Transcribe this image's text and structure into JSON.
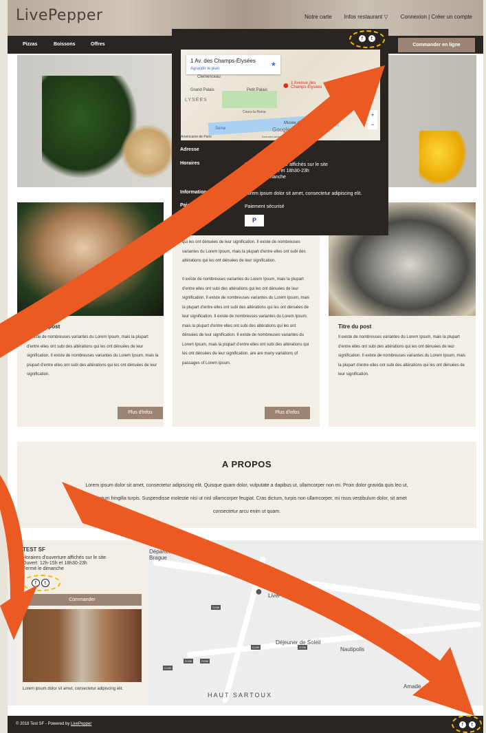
{
  "brand": {
    "logo": "LivePepper"
  },
  "topnav": {
    "items": [
      "Notre carte",
      "Infos restaurant ▽",
      "Connexion | Créer un compte"
    ]
  },
  "navbar": {
    "items": [
      "Pizzas",
      "Boissons",
      "Offres"
    ],
    "order_label": "Commander en ligne"
  },
  "dropdown": {
    "map_address": "1 Av. des Champs-Élysées",
    "map_enlarge": "Agrandir le plan",
    "map_pin_label": "1 Avenue des Champs-Élysées",
    "map_places": [
      "Clemenceau",
      "Grand Palais",
      "Petit Palais",
      "LYSÉES",
      "Cours-la-Reine",
      "Seine",
      "Musée de l'Orangerie",
      "Seine",
      "Américaine de Paris"
    ],
    "map_footer": "Données cartographiques  Conditions d'utilisation",
    "google": "Google",
    "rows": [
      {
        "label": "Adresse",
        "value": ""
      },
      {
        "label": "Horaires",
        "value": "Horaires d'ouverture affichés sur le site\nOuvert: 12h-15h et 18h30-23h\nFermé le dimanche"
      },
      {
        "label": "Information",
        "value": "Lorem ipsum dolor sit amet, consectetur adipiscing elit."
      },
      {
        "label": "Paiement",
        "value": "Paiement sécurisé"
      }
    ],
    "pay_icon": "P"
  },
  "cards": [
    {
      "title": "Titre du post",
      "text": "Il existe de nombreuses variantes du Lorem Ipsum, mais la plupart d'entre elles ont subi des altérations qui les ont dénuées de leur signification. Il existe de nombreuses variantes du Lorem Ipsum, mais la plupart d'entre elles ont subi des altérations qui les ont dénuées de leur signification.",
      "button": "Plus d'infos"
    },
    {
      "title": "",
      "text": "qui les ont dénuées de leur signification. Il existe de nombreuses variantes du Lorem Ipsum, mais la plupart d'entre elles ont subi des altérations qui les ont dénuées de leur signification.\n\nIl existe de nombreuses variantes du Lorem Ipsum, mais la plupart d'entre elles ont subi des altérations qui les ont dénuées de leur signification. Il existe de nombreuses variantes du Lorem Ipsum, mais la plupart d'entre elles ont subi des altérations qui les ont dénuées de leur signification. Il existe de nombreuses variantes du Lorem Ipsum, mais la plupart d'entre elles ont subi des altérations qui les ont dénuées de leur signification. Il existe de nombreuses variantes du Lorem Ipsum, mais la plupart d'entre elles ont subi des altérations qui les ont dénuées de leur signification. are are many variations of passages of Lorem Ipsum.",
      "button": "Plus d'infos"
    },
    {
      "title": "Titre du post",
      "text": "Il existe de nombreuses variantes du Lorem Ipsum, mais la plupart d'entre elles ont subi des altérations qui les ont dénuées de leur signification. Il existe de nombreuses variantes du Lorem Ipsum, mais la plupart d'entre elles ont subi des altérations qui les ont dénuées de leur signification.",
      "button": ""
    }
  ],
  "about": {
    "title": "A PROPOS",
    "text": "Lorem ipsum dolor sit amet, consectetur adipiscing elit. Quisque quam dolor, vulputate a dapibus ut, ullamcorper non mi. Proin dolor gravida quis leo ut, fermentum fringilla turpis. Suspendisse molestie nisi ut nisl ullamcorper feugiat. Cras dictum, turpis non ullamcorper, mi risus vestibulum dolor, sit amet consectetur arcu enim ut quam."
  },
  "location": {
    "name": "TEST SF",
    "hours": "Horaires d'ouverture affichés sur le site\nOuvert: 12h-15h et 18h30-23h\nFermé le dimanche",
    "order_label": "Commander",
    "desc": "Lorem ipsum dolor sit amet, consectetur adipiscing elit.",
    "map_places": [
      "Département de la Brague",
      "LivePepper",
      "Déjeuner de Soleil",
      "Nautipolis",
      "HAUT SARTOUX",
      "Amade"
    ],
    "road_tags": [
      "D198",
      "D198",
      "D198",
      "D198",
      "D198",
      "D298"
    ]
  },
  "footer": {
    "copy_prefix": "© 2018 Test SF - Powered by ",
    "copy_link": "LivePepper"
  },
  "social_icons": [
    "facebook-icon",
    "twitter-icon"
  ],
  "colors": {
    "dark": "#2b2521",
    "accent": "#9b8474",
    "card_bg": "#f3efe6",
    "arrow": "#ec5a24",
    "highlight": "#f5b800"
  }
}
